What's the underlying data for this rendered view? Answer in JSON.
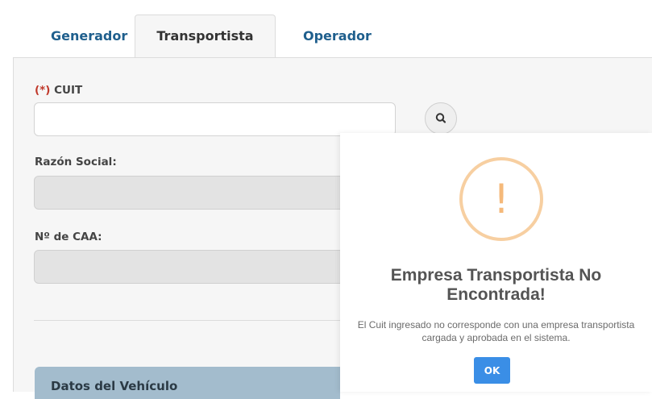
{
  "tabs": [
    {
      "label": "Generador",
      "active": false
    },
    {
      "label": "Transportista",
      "active": true
    },
    {
      "label": "Operador",
      "active": false
    }
  ],
  "form": {
    "cuit": {
      "required_mark": "(*)",
      "label": "CUIT",
      "value": "",
      "placeholder": ""
    },
    "razon_social": {
      "label": "Razón Social:",
      "value": ""
    },
    "caa": {
      "label": "Nº de CAA:",
      "value": ""
    }
  },
  "section": {
    "vehiculo_title": "Datos del Vehículo"
  },
  "modal": {
    "icon": "warning-icon",
    "icon_glyph": "!",
    "title": "Empresa Transportista No Encontrada!",
    "text": "El Cuit ingresado no corresponde con una empresa transportista cargada y aprobada en el sistema.",
    "ok_label": "OK"
  },
  "colors": {
    "tab_link": "#1f5f8d",
    "warning": "#f5b97a",
    "ok_button": "#3a8ee6",
    "required": "#c0392b",
    "section_header": "#a3bccd"
  }
}
